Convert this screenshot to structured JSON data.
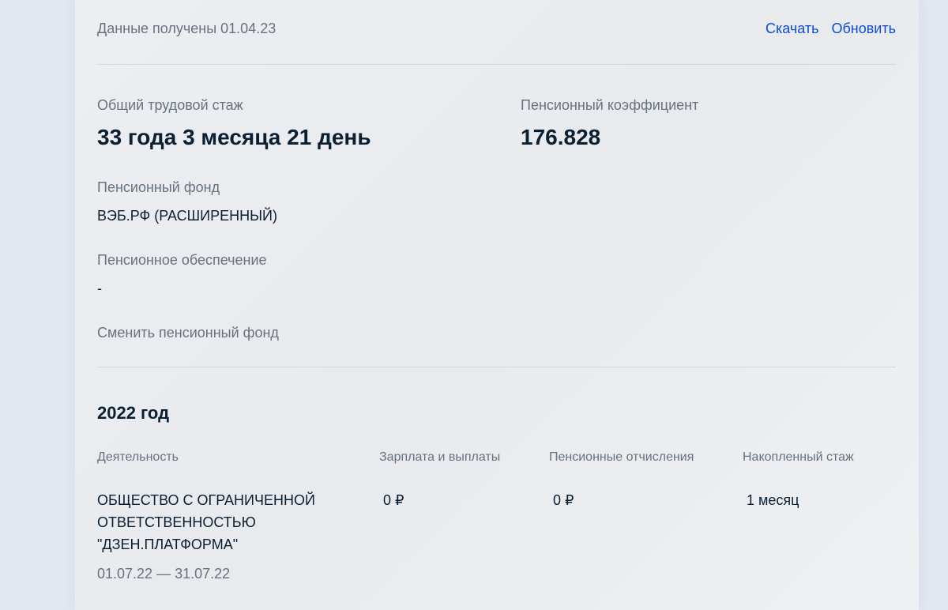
{
  "header": {
    "received_label": "Данные получены 01.04.23",
    "download_label": "Скачать",
    "refresh_label": "Обновить"
  },
  "summary": {
    "experience_label": "Общий трудовой стаж",
    "experience_value": "33 года 3 месяца 21 день",
    "coefficient_label": "Пенсионный коэффициент",
    "coefficient_value": "176.828",
    "fund_label": "Пенсионный фонд",
    "fund_value": "ВЭБ.РФ (РАСШИРЕННЫЙ)",
    "provision_label": "Пенсионное обеспечение",
    "provision_value": "-",
    "change_fund_label": "Сменить пенсионный фонд"
  },
  "year_section": {
    "title": "2022 год",
    "columns": [
      "Деятельность",
      "Зарплата и выплаты",
      "Пенсионные отчисления",
      "Накопленный стаж"
    ],
    "rows": [
      {
        "employer_lines": [
          "ОБЩЕСТВО С ОГРАНИЧЕННОЙ",
          "ОТВЕТСТВЕННОСТЬЮ",
          "\"ДЗЕН.ПЛАТФОРМА\""
        ],
        "period": "01.07.22 — 31.07.22",
        "salary": "0 ₽",
        "contributions": "0 ₽",
        "experience": "1 месяц"
      }
    ]
  }
}
